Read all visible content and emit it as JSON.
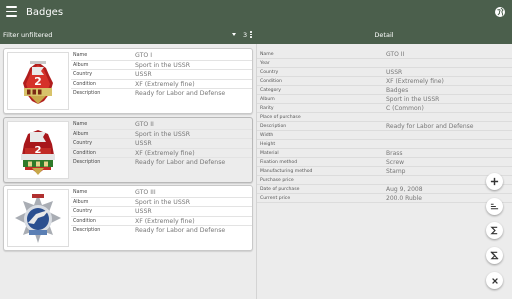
{
  "appbar": {
    "title": "Badges",
    "menu_icon": "menu-icon",
    "globe_icon": "globe-icon"
  },
  "filter": {
    "label": "Filter",
    "value": "unfiltered",
    "count": "3"
  },
  "detail_header": {
    "title": "Detail"
  },
  "colors": {
    "appbar": "#4b5f4c",
    "background": "#ececec",
    "card": "#ffffff"
  },
  "list": {
    "field_labels": [
      "Name",
      "Album",
      "Country",
      "Condition",
      "Description"
    ],
    "items": [
      {
        "values": [
          "GTO I",
          "Sport in the USSR",
          "USSR",
          "XF (Extremely fine)",
          "Ready for Labor and Defense"
        ]
      },
      {
        "values": [
          "GTO II",
          "Sport in the USSR",
          "USSR",
          "XF (Extremely fine)",
          "Ready for Labor and Defense"
        ]
      },
      {
        "values": [
          "GTO III",
          "Sport in the USSR",
          "USSR",
          "XF (Extremely fine)",
          "Ready for Labor and Defense"
        ]
      }
    ]
  },
  "detail": {
    "rows": [
      {
        "label": "Name",
        "value": "GTO II"
      },
      {
        "label": "Year",
        "value": ""
      },
      {
        "label": "Country",
        "value": "USSR"
      },
      {
        "label": "Condition",
        "value": "XF (Extremely fine)"
      },
      {
        "label": "Category",
        "value": "Badges"
      },
      {
        "label": "Album",
        "value": "Sport in the USSR"
      },
      {
        "label": "Rarity",
        "value": "C (Common)"
      },
      {
        "label": "Place of purchase",
        "value": ""
      },
      {
        "label": "Description",
        "value": "Ready for Labor and Defense"
      },
      {
        "label": "Width",
        "value": ""
      },
      {
        "label": "Height",
        "value": ""
      },
      {
        "label": "Material",
        "value": "Brass"
      },
      {
        "label": "Fixation method",
        "value": "Screw"
      },
      {
        "label": "Manufacturing method",
        "value": "Stamp"
      },
      {
        "label": "Purchase price",
        "value": ""
      },
      {
        "label": "Date of purchase",
        "value": "Aug 9, 2008"
      },
      {
        "label": "Current price",
        "value": "200.0 Ruble"
      }
    ]
  },
  "fab_icons": [
    "add-icon",
    "sort-icon",
    "sum-icon",
    "clear-sort-icon",
    "close-icon"
  ]
}
